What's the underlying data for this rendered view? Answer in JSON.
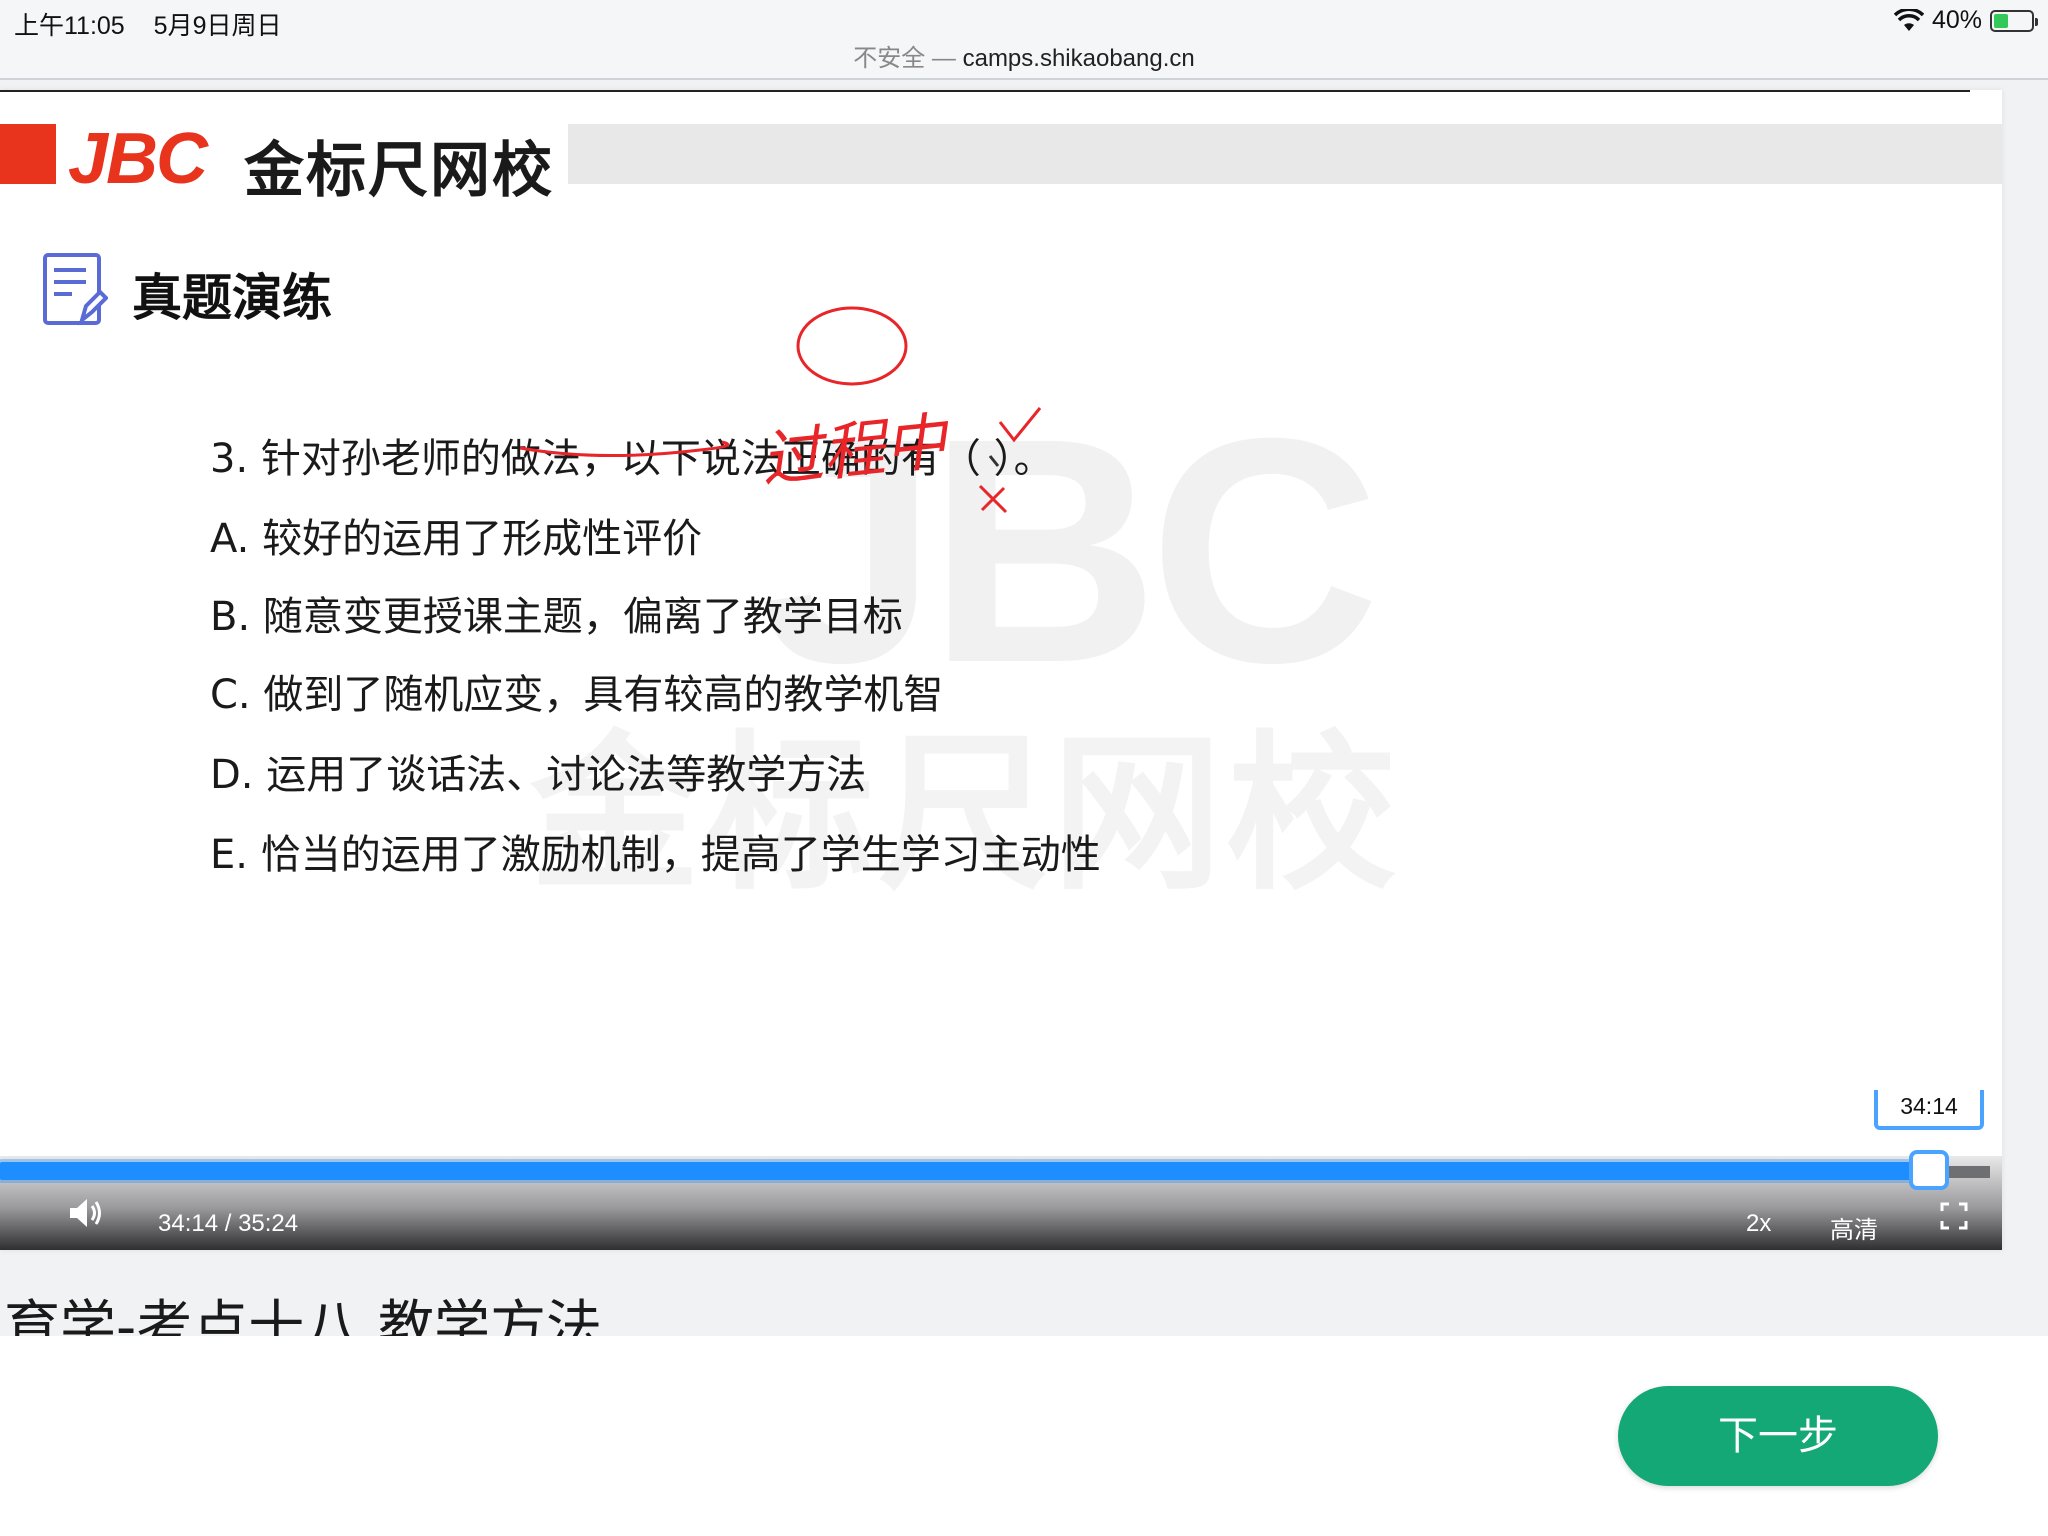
{
  "status_bar": {
    "time": "上午11:05",
    "date": "5月9日周日",
    "battery": "40%",
    "battery_level": 0.4
  },
  "address_bar": {
    "security_label": "不安全 —",
    "host": "camps.shikaobang.cn"
  },
  "slide": {
    "logo_latin": "JBC",
    "logo_cn": "金标尺网校",
    "section_title": "真题演练",
    "watermark_latin": "JBC",
    "watermark_cn": "金标尺网校",
    "question": "3. 针对孙老师的做法，以下说法正确的有（    ）。",
    "options": [
      "A. 较好的运用了形成性评价",
      "B. 随意变更授课主题，偏离了教学目标",
      "C. 做到了随机应变，具有较高的教学机智",
      "D. 运用了谈话法、讨论法等教学方法",
      "E. 恰当的运用了激励机制，提高了学生学习主动性"
    ],
    "handwritten_note": "过程中",
    "annotation_colors": {
      "ink": "#e8262a"
    }
  },
  "player": {
    "tooltip_time": "34:14",
    "time_display": "34:14 / 35:24",
    "progress": 0.9694,
    "speed_label": "2x",
    "quality_label": "高清",
    "icons": [
      "volume-icon",
      "fullscreen-icon"
    ],
    "accent_color": "#1e8dff"
  },
  "lesson": {
    "title": "育学-考点十八 教学方法"
  },
  "footer": {
    "next_button": "下一步",
    "button_color": "#13a876"
  }
}
